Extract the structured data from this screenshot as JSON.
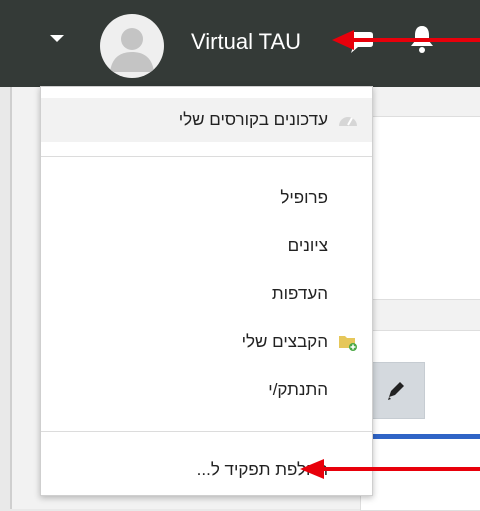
{
  "navbar": {
    "user_name": "Virtual TAU",
    "icons": [
      "caret-down-icon",
      "avatar-icon",
      "chat-icon",
      "bell-icon"
    ]
  },
  "user_menu": {
    "items": [
      {
        "label": "עדכונים בקורסים שלי",
        "icon": "dashboard-icon",
        "highlighted": true
      },
      {
        "label": "פרופיל"
      },
      {
        "label": "ציונים"
      },
      {
        "label": "העדפות"
      },
      {
        "label": "הקבצים שלי",
        "icon": "folder-add-icon"
      },
      {
        "label": "התנתק/י"
      },
      {
        "label": "החלפת תפקיד ל..."
      }
    ]
  },
  "annotations": {
    "arrow_color": "#e8000b",
    "count": 2
  },
  "colors": {
    "navbar": "#343a37",
    "accent_line": "#2f64c6"
  }
}
